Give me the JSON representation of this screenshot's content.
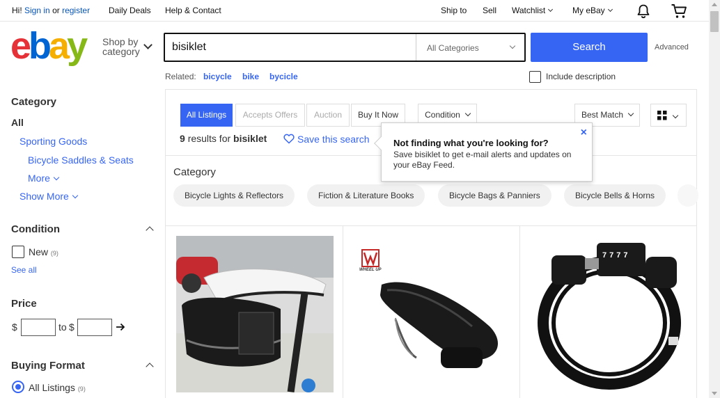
{
  "topbar": {
    "greeting": "Hi!",
    "sign_in": "Sign in",
    "or": "or",
    "register": "register",
    "daily_deals": "Daily Deals",
    "help_contact": "Help & Contact",
    "ship_to": "Ship to",
    "sell": "Sell",
    "watchlist": "Watchlist",
    "my_ebay": "My eBay"
  },
  "header": {
    "logo_letters": [
      "e",
      "b",
      "a",
      "y"
    ],
    "shop_by_line1": "Shop by",
    "shop_by_line2": "category",
    "search_value": "bisiklet",
    "category_select": "All Categories",
    "search_button": "Search",
    "advanced": "Advanced"
  },
  "related": {
    "label": "Related:",
    "items": [
      "bicycle",
      "bike",
      "bycicle"
    ],
    "include_description": "Include description"
  },
  "sidebar": {
    "category_heading": "Category",
    "all": "All",
    "sporting_goods": "Sporting Goods",
    "bicycle_saddles": "Bicycle Saddles & Seats",
    "more": "More",
    "show_more": "Show More",
    "condition_heading": "Condition",
    "new_label": "New",
    "new_count": "(9)",
    "see_all": "See all",
    "price_heading": "Price",
    "currency": "$",
    "to": "to",
    "buying_format_heading": "Buying Format",
    "all_listings": "All Listings",
    "all_listings_count": "(9)"
  },
  "filters": {
    "tabs": [
      "All Listings",
      "Accepts Offers",
      "Auction",
      "Buy It Now"
    ],
    "condition": "Condition",
    "sort": "Best Match"
  },
  "results": {
    "count": "9",
    "results_for": "results for",
    "query": "bisiklet",
    "save_search": "Save this search"
  },
  "tooltip": {
    "title": "Not finding what you're looking for?",
    "body": "Save bisiklet to get e-mail alerts and updates on your eBay Feed.",
    "close": "×"
  },
  "category_chips": {
    "heading": "Category",
    "items": [
      "Bicycle Lights & Reflectors",
      "Fiction & Literature Books",
      "Bicycle Bags & Panniers",
      "Bicycle Bells & Horns"
    ]
  },
  "product_brand": "WHEEL UP",
  "lock_digits": "7777",
  "colors": {
    "accent": "#3665f3",
    "link": "#0654ba"
  }
}
